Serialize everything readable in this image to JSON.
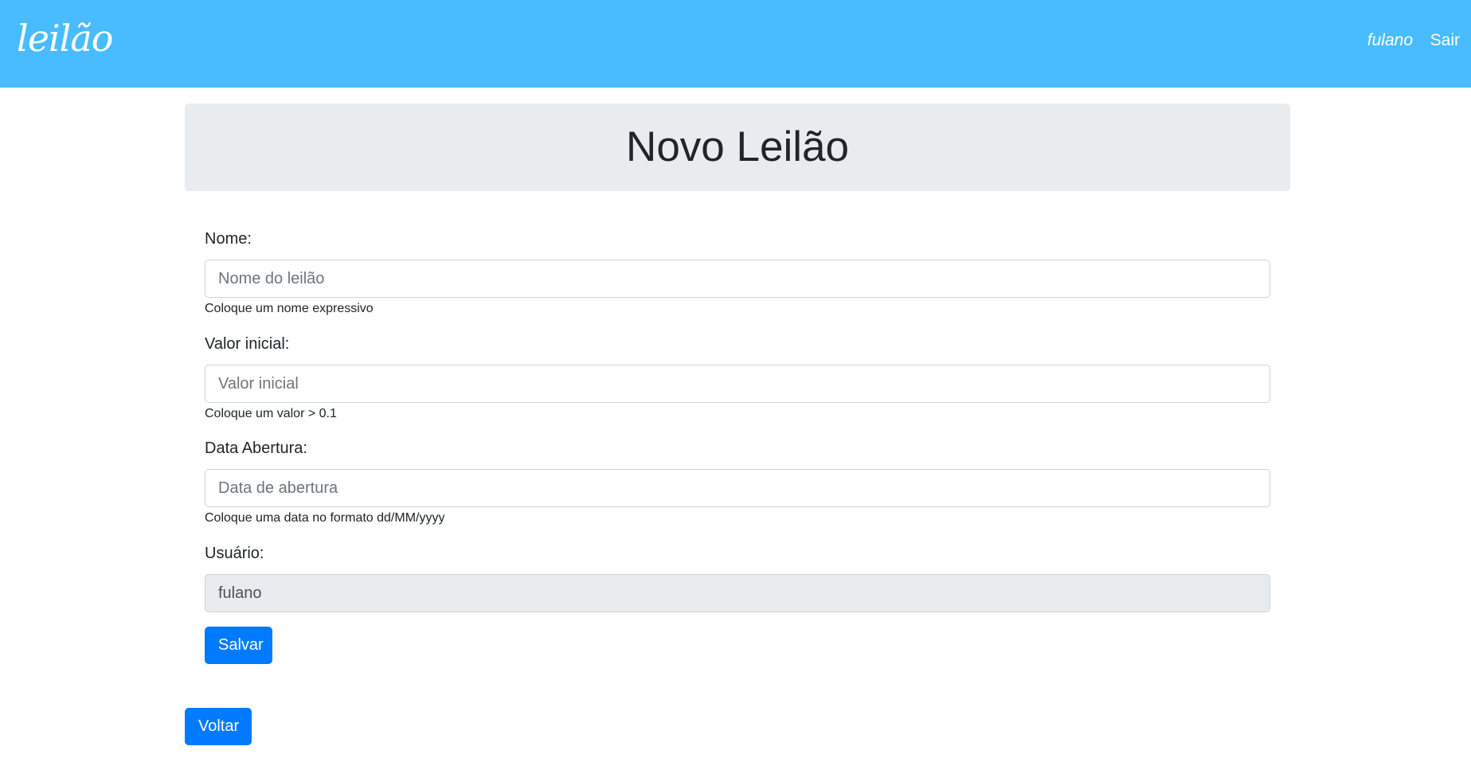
{
  "navbar": {
    "brand": "leilão",
    "user": "fulano",
    "logout": "Sair"
  },
  "header": {
    "title": "Novo Leilão"
  },
  "form": {
    "nome": {
      "label": "Nome:",
      "placeholder": "Nome do leilão",
      "value": "",
      "help": "Coloque um nome expressivo"
    },
    "valor": {
      "label": "Valor inicial:",
      "placeholder": "Valor inicial",
      "value": "",
      "help": "Coloque um valor > 0.1"
    },
    "data": {
      "label": "Data Abertura:",
      "placeholder": "Data de abertura",
      "value": "",
      "help": "Coloque uma data no formato dd/MM/yyyy"
    },
    "usuario": {
      "label": "Usuário:",
      "value": "fulano"
    },
    "save_label": "Salvar"
  },
  "footer": {
    "back_label": "Voltar"
  },
  "colors": {
    "navbar": "#48bcff",
    "primary": "#007bff",
    "jumbotron": "#e9ecef"
  }
}
